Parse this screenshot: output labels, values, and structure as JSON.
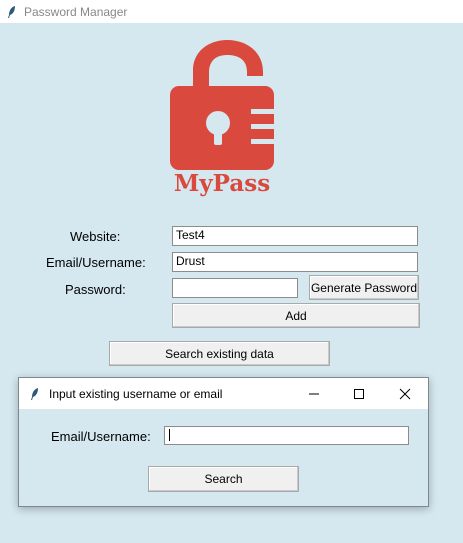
{
  "window": {
    "title": "Password Manager"
  },
  "logo": {
    "text": "MyPass",
    "color": "#d9493e"
  },
  "form": {
    "website_label": "Website:",
    "website_value": "Test4",
    "email_label": "Email/Username:",
    "email_value": "Drust",
    "password_label": "Password:",
    "password_value": "",
    "generate_button": "Generate Password",
    "add_button": "Add",
    "search_button": "Search existing data"
  },
  "dialog": {
    "title": "Input existing username or email",
    "email_label": "Email/Username:",
    "email_value": "",
    "search_button": "Search"
  },
  "colors": {
    "background": "#d5e8ef",
    "titlebar": "#ffffff",
    "button": "#f0f0f0"
  }
}
